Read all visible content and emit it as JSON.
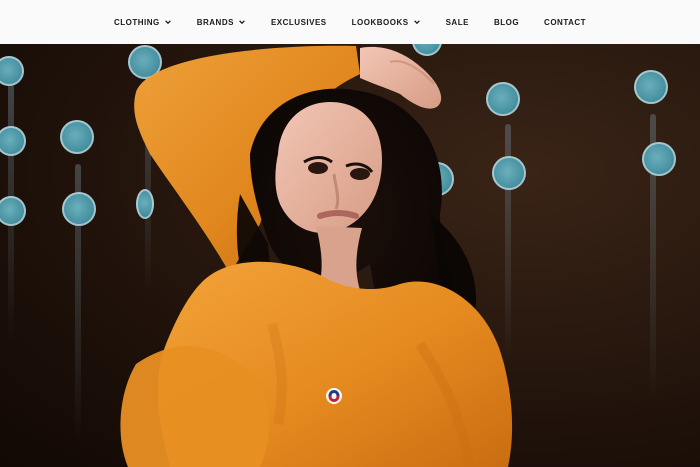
{
  "nav": {
    "items": [
      {
        "label": "CLOTHING",
        "has_dropdown": true
      },
      {
        "label": "BRANDS",
        "has_dropdown": true
      },
      {
        "label": "EXCLUSIVES",
        "has_dropdown": false
      },
      {
        "label": "LOOKBOOKS",
        "has_dropdown": true
      },
      {
        "label": "SALE",
        "has_dropdown": false
      },
      {
        "label": "BLOG",
        "has_dropdown": false
      },
      {
        "label": "CONTACT",
        "has_dropdown": false
      }
    ]
  },
  "colors": {
    "nav_bg": "#fafafa",
    "nav_text": "#1b1b1b",
    "sweatshirt": "#e58a1f",
    "wall": "#2b1a10",
    "wall_dot": "#4b9aab"
  },
  "hero": {
    "icons": [
      "sweatshirt-logo-icon"
    ]
  }
}
